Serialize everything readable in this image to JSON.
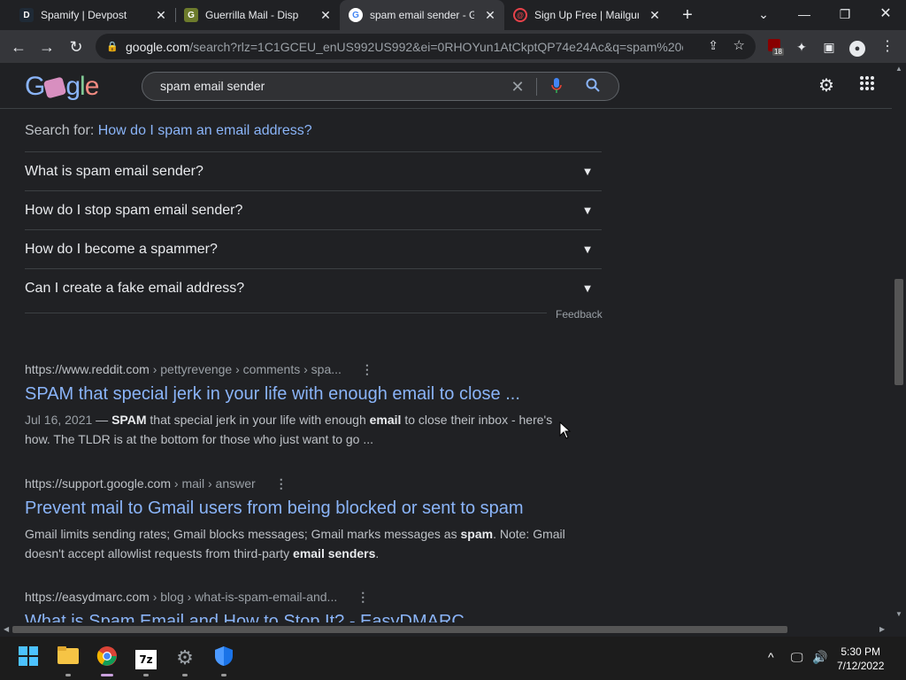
{
  "tabs": [
    {
      "title": "Spamify | Devpost",
      "favicon": "devpost-icon",
      "active": false
    },
    {
      "title": "Guerrilla Mail - Disp",
      "favicon": "guerrilla-mail-icon",
      "active": false
    },
    {
      "title": "spam email sender - G",
      "favicon": "google-icon",
      "active": true
    },
    {
      "title": "Sign Up Free | Mailgun",
      "favicon": "mailgun-icon",
      "active": false
    }
  ],
  "toolbar": {
    "url_host": "google.com",
    "url_rest": "/search?rlz=1C1GCEU_enUS992US992&ei=0RHOYun1AtCkptQP74e24Ac&q=spam%20e...",
    "extension_badge": "18"
  },
  "search": {
    "query": "spam email sender"
  },
  "searchfor": {
    "label": "Search for:",
    "link": "How do I spam an email address?"
  },
  "faqs": [
    "What is spam email sender?",
    "How do I stop spam email sender?",
    "How do I become a spammer?",
    "Can I create a fake email address?"
  ],
  "feedback": "Feedback",
  "results": [
    {
      "site": "https://www.reddit.com",
      "path": " › pettyrevenge › comments › spa...",
      "title": "SPAM that special jerk in your life with enough email to close ...",
      "date": "Jul 16, 2021",
      "snippet_parts": [
        " — ",
        "SPAM",
        " that special jerk in your life with enough ",
        "email",
        " to close their inbox - here's how. The TLDR is at the bottom for those who just want to go ..."
      ]
    },
    {
      "site": "https://support.google.com",
      "path": " › mail › answer",
      "title": "Prevent mail to Gmail users from being blocked or sent to spam",
      "snippet_parts": [
        "Gmail limits sending rates; Gmail blocks messages; Gmail marks messages as ",
        "spam",
        ". Note: Gmail doesn't accept allowlist requests from third-party ",
        "email senders",
        "."
      ]
    },
    {
      "site": "https://easydmarc.com",
      "path": " › blog › what-is-spam-email-and...",
      "title": "What is Spam Email and How to Stop It? - EasyDMARC"
    }
  ],
  "clock": {
    "time": "5:30 PM",
    "date": "7/12/2022"
  }
}
